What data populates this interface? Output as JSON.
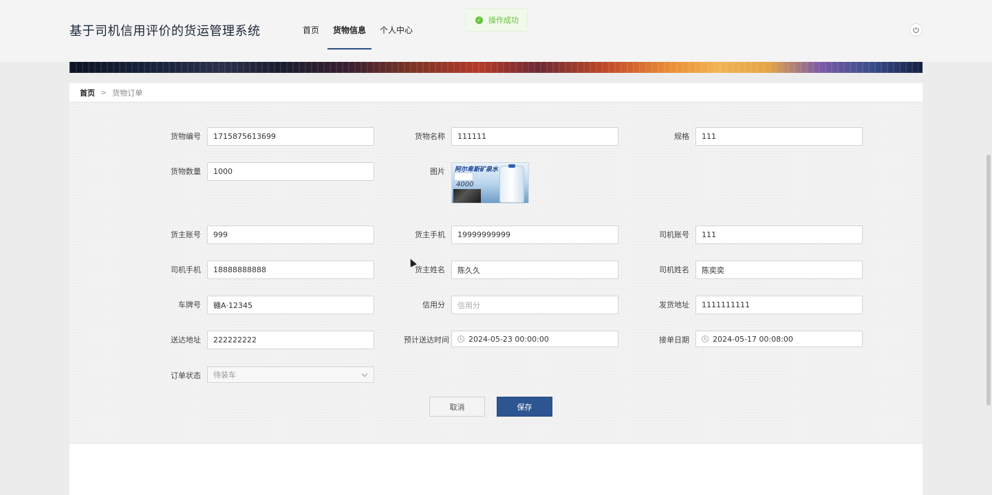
{
  "header": {
    "title": "基于司机信用评价的货运管理系统",
    "nav": [
      {
        "label": "首页",
        "active": false
      },
      {
        "label": "货物信息",
        "active": true
      },
      {
        "label": "个人中心",
        "active": false
      }
    ],
    "power_icon": "power-icon"
  },
  "toast": {
    "icon": "check-circle-icon",
    "text": "操作成功",
    "color": "#67c23a"
  },
  "breadcrumb": {
    "home": "首页",
    "separator": ">",
    "current": "货物订单"
  },
  "form": {
    "goods_no": {
      "label": "货物编号",
      "value": "1715875613699"
    },
    "goods_name": {
      "label": "货物名称",
      "value": "111111"
    },
    "spec": {
      "label": "规格",
      "value": "111"
    },
    "quantity": {
      "label": "货物数量",
      "value": "1000"
    },
    "image": {
      "label": "图片",
      "brand_text": "阿尔卑斯矿泉水",
      "sub_text": "4000"
    },
    "owner_account": {
      "label": "货主账号",
      "value": "999"
    },
    "owner_phone": {
      "label": "货主手机",
      "value": "19999999999"
    },
    "driver_account": {
      "label": "司机账号",
      "value": "111"
    },
    "driver_phone": {
      "label": "司机手机",
      "value": "18888888888"
    },
    "owner_name": {
      "label": "货主姓名",
      "value": "陈久久"
    },
    "driver_name": {
      "label": "司机姓名",
      "value": "陈奕奕"
    },
    "plate": {
      "label": "车牌号",
      "value": "赣A·12345"
    },
    "credit": {
      "label": "信用分",
      "placeholder": "信用分"
    },
    "ship_address": {
      "label": "发货地址",
      "value": "1111111111"
    },
    "delivery_address": {
      "label": "送达地址",
      "value": "222222222"
    },
    "eta": {
      "label": "预计送达时间",
      "value": "2024-05-23 00:00:00"
    },
    "accept_date": {
      "label": "接单日期",
      "value": "2024-05-17 00:08:00"
    },
    "status": {
      "label": "订单状态",
      "value": "待装车"
    }
  },
  "buttons": {
    "cancel": "取消",
    "save": "保存"
  },
  "colors": {
    "primary": "#2c5591",
    "success": "#67c23a"
  }
}
